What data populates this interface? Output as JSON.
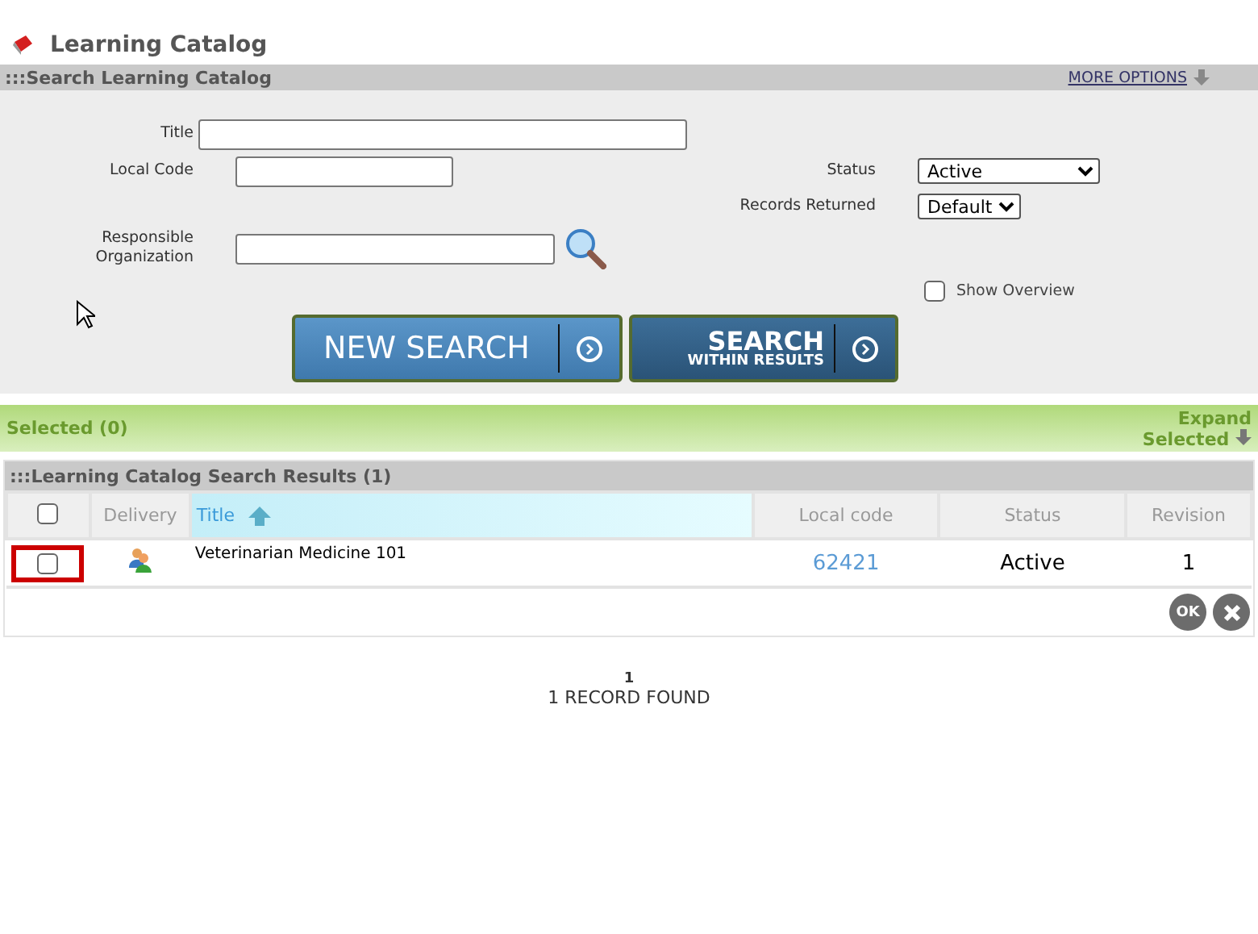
{
  "page_title": "Learning Catalog",
  "search_panel": {
    "header": ":::Search Learning Catalog",
    "more_options": "MORE OPTIONS",
    "fields": {
      "title": {
        "label": "Title"
      },
      "local_code": {
        "label": "Local Code"
      },
      "responsible_organization": {
        "label": "Responsible Organization"
      }
    },
    "status": {
      "label": "Status",
      "value": "Active"
    },
    "records_returned": {
      "label": "Records Returned",
      "value": "Default"
    },
    "show_overview": {
      "label": "Show Overview",
      "checked": false
    },
    "new_search_button": "NEW SEARCH",
    "search_within_button": {
      "line1": "SEARCH",
      "line2": "WITHIN RESULTS"
    }
  },
  "selected_bar": {
    "label": "Selected (0)",
    "expand": "Expand Selected"
  },
  "results": {
    "header": ":::Learning Catalog Search Results (1)",
    "columns": [
      {
        "kind": "checkbox",
        "checked": false
      },
      {
        "kind": "text",
        "label": "Delivery"
      },
      {
        "kind": "sorted",
        "label": "Title"
      },
      {
        "kind": "text",
        "label": "Local code"
      },
      {
        "kind": "text",
        "label": "Status"
      },
      {
        "kind": "text",
        "label": "Revision"
      }
    ],
    "rows": [
      {
        "checked": false,
        "highlighted": true,
        "title": "Veterinarian Medicine 101",
        "local_code": "62421",
        "status": "Active",
        "revision": "1"
      }
    ],
    "ok_button": "OK"
  },
  "pagination": {
    "page": "1",
    "summary": "1 RECORD FOUND"
  }
}
